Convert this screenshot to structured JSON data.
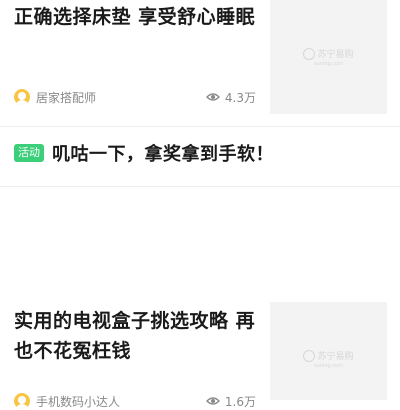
{
  "articles": [
    {
      "title_lines": [
        "正确选择床垫  享受舒心睡眠"
      ],
      "author": "居家搭配师",
      "views": "4.3万",
      "thumb_watermark": {
        "brand": "苏宁易购",
        "domain": "suning.com"
      }
    },
    {
      "title_lines": [
        "实用的电视盒子挑选攻略 再",
        "也不花冤枉钱"
      ],
      "author": "手机数码小达人",
      "views": "1.6万",
      "thumb_watermark": {
        "brand": "苏宁易购",
        "domain": "suning.com"
      }
    }
  ],
  "promo": {
    "tag": "活动",
    "text": "叽咕一下，拿奖拿到手软！"
  },
  "colors": {
    "tag_green": "#3ccf7a",
    "author_icon_yellow": "#f6c545",
    "meta_gray": "#888888"
  }
}
